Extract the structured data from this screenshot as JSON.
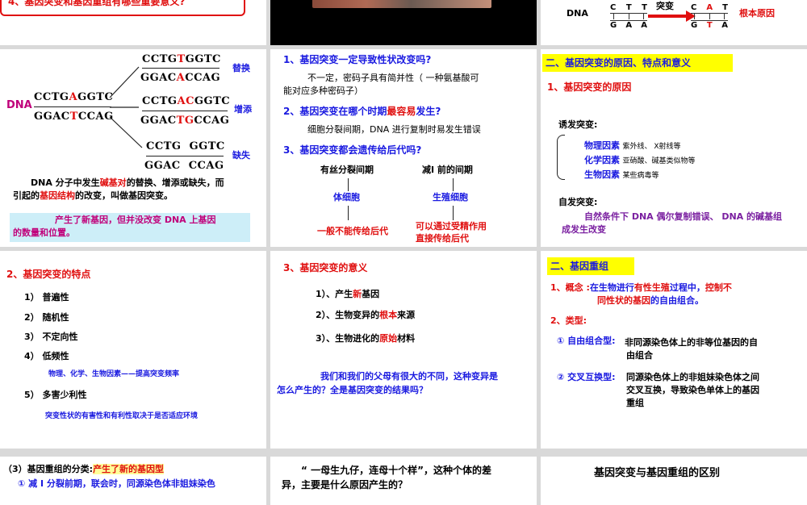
{
  "s1": {
    "title": "4、基因突变和基因重组有哪些重要意义?"
  },
  "s3": {
    "dna_label": "DNA",
    "top_left": [
      "C",
      "T",
      "T"
    ],
    "bottom_left": [
      "G",
      "A",
      "A"
    ],
    "arrow_label": "突变",
    "top_right": [
      "C",
      "A",
      "T"
    ],
    "bottom_right": [
      "G",
      "T",
      "A"
    ],
    "root_cause": "根本原因"
  },
  "s4": {
    "dna_label": "DNA",
    "orig_top": [
      "CCTG",
      "A",
      "GGTC"
    ],
    "orig_bottom": [
      "GGAC",
      "T",
      "CCAG"
    ],
    "sub_top": [
      "CCTG",
      "T",
      "GGTC"
    ],
    "sub_bottom": [
      "GGAC",
      "A",
      "CCAG"
    ],
    "add_top": [
      "CCTG",
      "AC",
      "GGTC"
    ],
    "add_bottom": [
      "GGAC",
      "TG",
      "CCAG"
    ],
    "del_top": "CCTG  GGTC",
    "del_bottom": "GGAC  CCAG",
    "label_sub": "替换",
    "label_add": "增添",
    "label_del": "缺失",
    "def_1": "DNA 分子中发生",
    "def_2": "碱基对",
    "def_3": "的替换、增添或缺失，而",
    "def_4": "引起的",
    "def_5": "基因结构",
    "def_6": "的改变，叫做基因突变。",
    "note_1": "产生了新基因，但并没改变 DNA 上基因",
    "note_2": "的数量和位置。"
  },
  "s5": {
    "q1": "1、基因突变一定导致性状改变吗?",
    "a1_1": "不一定，密码子具有简并性（ 一种氨基酸可",
    "a1_2": "能对应多种密码子）",
    "q2_a": "2、基因突变在哪个时期",
    "q2_b": "最容易",
    "q2_c": "发生?",
    "a2": "细胞分裂间期，DNA 进行复制时易发生错误",
    "q3": "3、基因突变都会遗传给后代吗?",
    "left_head": "有丝分裂间期",
    "right_head": "减Ⅰ 前的间期",
    "left_mid": "体细胞",
    "right_mid": "生殖细胞",
    "left_end": "一般不能传给后代",
    "right_end_1": "可以通过受精作用",
    "right_end_2": "直接传给后代"
  },
  "s6": {
    "title": "二、基因突变的原因、特点和意义",
    "sub": "1、基因突变的原因",
    "induced": "诱发突变:",
    "phys_label": "物理因素",
    "phys_text": "紫外线、 X射线等",
    "chem_label": "化学因素",
    "chem_text": "亚硝酸、碱基类似物等",
    "bio_label": "生物因素",
    "bio_text": "某些病毒等",
    "spont": "自发突变:",
    "spont_1": "自然条件下 DNA 偶尔复制错误、 DNA 的碱基组",
    "spont_2": "成发生改变"
  },
  "s7": {
    "title": "2、基因突变的特点",
    "f1": "1）  普遍性",
    "f2": "2）  随机性",
    "f3": "3）  不定向性",
    "f4": "4）  低频性",
    "f4_note": "物理、化学、生物因素——提高突变频率",
    "f5": "5）  多害少利性",
    "f5_note": "突变性状的有害性和有利性取决于是否适应环境"
  },
  "s8": {
    "title": "3、基因突变的意义",
    "m1_a": "1）、产生",
    "m1_b": "新",
    "m1_c": "基因",
    "m2_a": "2）、生物变异的",
    "m2_b": "根本",
    "m2_c": "来源",
    "m3_a": "3）、生物进化的",
    "m3_b": "原始",
    "m3_c": "材料",
    "q_1": "我们和我们的父母有很大的不同，这种变异是",
    "q_2": "怎么产生的？全是基因突变的结果吗？"
  },
  "s9": {
    "title": "二、基因重组",
    "c_label": "1、概念 :",
    "c_1": "在生物进行",
    "c_2": "有性生殖",
    "c_3": "过程中，",
    "c_4": "控制不",
    "c_5": "同性状的基因",
    "c_6": "的自由组合。",
    "type_label": "2、类型:",
    "t1_label": "① 自由组合型:",
    "t1_1": "非同源染色体上的非等位基因的自",
    "t1_2": "由组合",
    "t2_label": "② 交叉互换型:",
    "t2_1": "同源染色体上的非姐妹染色体之间",
    "t2_2": "交叉互换，导致染色单体上的基因",
    "t2_3": "重组"
  },
  "s10": {
    "a": "（3）基因重组的分类:",
    "b": "产生了新的基因型",
    "c": "① 减 Ⅰ 分裂前期，联会时，同源染色体非姐妹染色"
  },
  "s11": {
    "a": "“ 一母生九仔，连母十个样”，这种个体的差",
    "b": "异，主要是什么原因产生的？"
  },
  "s12": {
    "title": "基因突变与基因重组的区别"
  }
}
